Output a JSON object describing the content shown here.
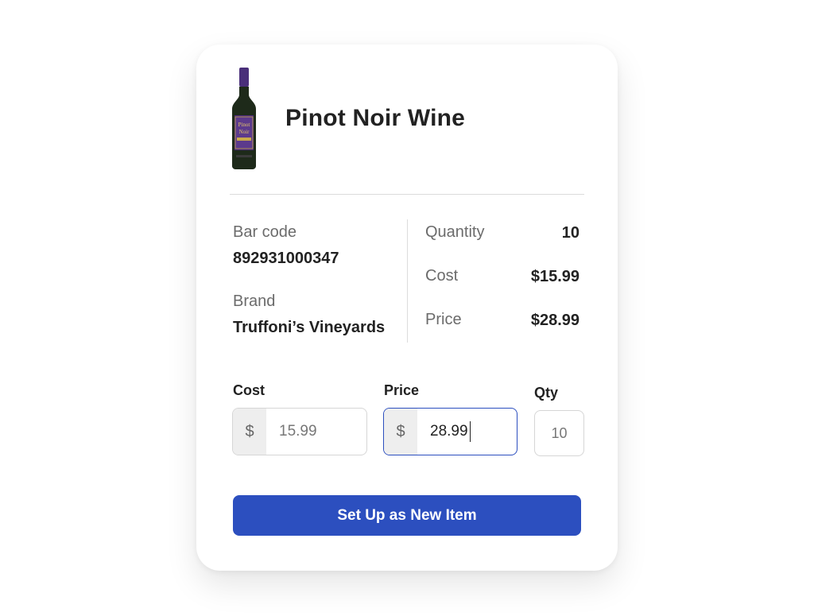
{
  "product": {
    "name": "Pinot Noir Wine",
    "bottle_label_line1": "Pinot",
    "bottle_label_line2": "Noir"
  },
  "details": {
    "barcode_label": "Bar code",
    "barcode_value": "892931000347",
    "brand_label": "Brand",
    "brand_value": "Truffoni’s Vineyards",
    "quantity_label": "Quantity",
    "quantity_value": "10",
    "cost_label": "Cost",
    "cost_value": "$15.99",
    "price_label": "Price",
    "price_value": "$28.99"
  },
  "form": {
    "cost": {
      "label": "Cost",
      "prefix": "$",
      "value": "15.99"
    },
    "price": {
      "label": "Price",
      "prefix": "$",
      "value": "28.99"
    },
    "qty": {
      "label": "Qty",
      "value": "10"
    }
  },
  "actions": {
    "setup_label": "Set Up as New Item"
  },
  "colors": {
    "accent": "#2c4fbf",
    "bottle_body": "#1e2a1a",
    "bottle_cap": "#4a2f7a",
    "label_purple": "#4b2a7a"
  }
}
